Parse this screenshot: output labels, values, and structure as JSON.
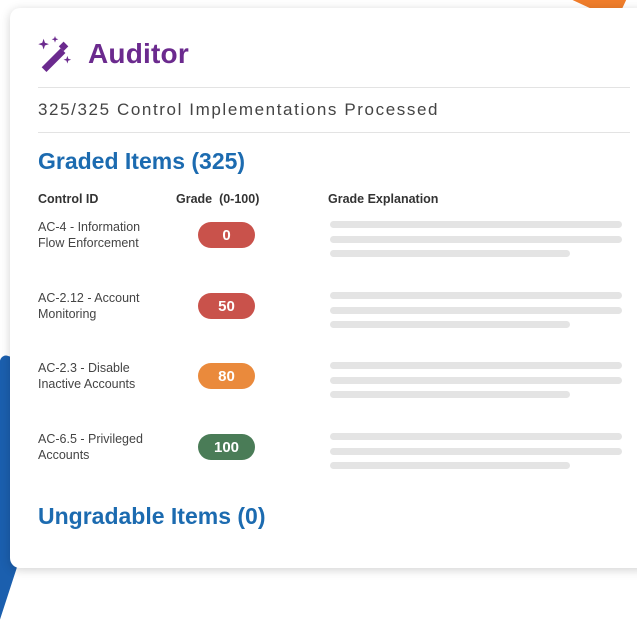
{
  "app": {
    "title": "Auditor"
  },
  "status_text": "325/325 Control Implementations Processed",
  "graded": {
    "title": "Graded Items (325)",
    "columns": {
      "control_id": "Control ID",
      "grade": "Grade  (0-100)",
      "explanation": "Grade Explanation"
    },
    "rows": [
      {
        "control": "AC-4 - Information Flow Enforcement",
        "grade": "0",
        "color": "#c9524b"
      },
      {
        "control": "AC-2.12 - Account Monitoring",
        "grade": "50",
        "color": "#c9524b"
      },
      {
        "control": "AC-2.3 - Disable Inactive Accounts",
        "grade": "80",
        "color": "#ea8a3c"
      },
      {
        "control": "AC-6.5 - Privileged Accounts",
        "grade": "100",
        "color": "#4a7c57"
      }
    ]
  },
  "ungradable": {
    "title": "Ungradable Items (0)"
  },
  "colors": {
    "brand_purple": "#6b2a8e",
    "section_blue": "#1c6bb0",
    "accent_orange": "#f07d2a",
    "accent_blue": "#1b5fae"
  },
  "icons": {
    "app_icon": "magic-wand-icon"
  }
}
